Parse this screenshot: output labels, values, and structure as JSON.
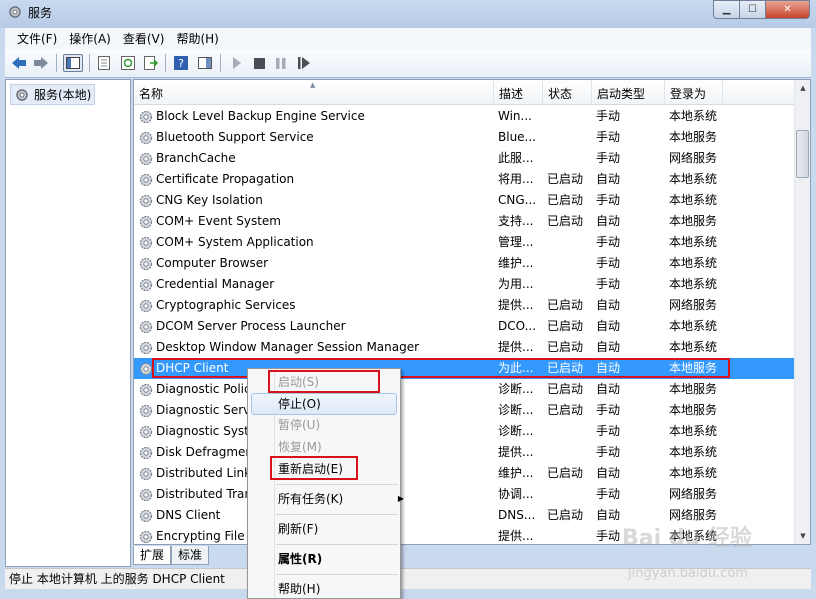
{
  "window": {
    "title": "服务"
  },
  "menubar": [
    {
      "label": "文件(F)"
    },
    {
      "label": "操作(A)"
    },
    {
      "label": "查看(V)"
    },
    {
      "label": "帮助(H)"
    }
  ],
  "tree": {
    "root_label": "服务(本地)"
  },
  "columns": {
    "name": "名称",
    "description": "描述",
    "status": "状态",
    "startup": "启动类型",
    "logon": "登录为"
  },
  "services": [
    {
      "name": "Block Level Backup Engine Service",
      "desc": "Win...",
      "status": "",
      "startup": "手动",
      "logon": "本地系统"
    },
    {
      "name": "Bluetooth Support Service",
      "desc": "Blue...",
      "status": "",
      "startup": "手动",
      "logon": "本地服务"
    },
    {
      "name": "BranchCache",
      "desc": "此服...",
      "status": "",
      "startup": "手动",
      "logon": "网络服务"
    },
    {
      "name": "Certificate Propagation",
      "desc": "将用...",
      "status": "已启动",
      "startup": "自动",
      "logon": "本地系统"
    },
    {
      "name": "CNG Key Isolation",
      "desc": "CNG...",
      "status": "已启动",
      "startup": "手动",
      "logon": "本地系统"
    },
    {
      "name": "COM+ Event System",
      "desc": "支持...",
      "status": "已启动",
      "startup": "自动",
      "logon": "本地服务"
    },
    {
      "name": "COM+ System Application",
      "desc": "管理...",
      "status": "",
      "startup": "手动",
      "logon": "本地系统"
    },
    {
      "name": "Computer Browser",
      "desc": "维护...",
      "status": "",
      "startup": "手动",
      "logon": "本地系统"
    },
    {
      "name": "Credential Manager",
      "desc": "为用...",
      "status": "",
      "startup": "手动",
      "logon": "本地系统"
    },
    {
      "name": "Cryptographic Services",
      "desc": "提供...",
      "status": "已启动",
      "startup": "自动",
      "logon": "网络服务"
    },
    {
      "name": "DCOM Server Process Launcher",
      "desc": "DCO...",
      "status": "已启动",
      "startup": "自动",
      "logon": "本地系统"
    },
    {
      "name": "Desktop Window Manager Session Manager",
      "desc": "提供...",
      "status": "已启动",
      "startup": "自动",
      "logon": "本地系统"
    },
    {
      "name": "DHCP Client",
      "desc": "为此...",
      "status": "已启动",
      "startup": "自动",
      "logon": "本地服务"
    },
    {
      "name": "Diagnostic Polic",
      "desc": "诊断...",
      "status": "已启动",
      "startup": "自动",
      "logon": "本地服务"
    },
    {
      "name": "Diagnostic Servi",
      "desc": "诊断...",
      "status": "已启动",
      "startup": "手动",
      "logon": "本地服务"
    },
    {
      "name": "Diagnostic Syste",
      "desc": "诊断...",
      "status": "",
      "startup": "手动",
      "logon": "本地系统"
    },
    {
      "name": "Disk Defragmen",
      "desc": "提供...",
      "status": "",
      "startup": "手动",
      "logon": "本地系统"
    },
    {
      "name": "Distributed Link",
      "desc": "维护...",
      "status": "已启动",
      "startup": "自动",
      "logon": "本地系统"
    },
    {
      "name": "Distributed Tran",
      "desc": "协调...",
      "status": "",
      "startup": "手动",
      "logon": "网络服务"
    },
    {
      "name": "DNS Client",
      "desc": "DNS...",
      "status": "已启动",
      "startup": "自动",
      "logon": "网络服务"
    },
    {
      "name": "Encrypting File S",
      "desc": "提供...",
      "status": "",
      "startup": "手动",
      "logon": "本地系统"
    }
  ],
  "tabs": [
    {
      "label": "扩展"
    },
    {
      "label": "标准"
    }
  ],
  "statusbar": {
    "text": "停止 本地计算机 上的服务 DHCP Client"
  },
  "context_menu": {
    "start": "启动(S)",
    "stop": "停止(O)",
    "pause": "暂停(U)",
    "resume": "恢复(M)",
    "restart": "重新启动(E)",
    "all_tasks": "所有任务(K)",
    "refresh": "刷新(F)",
    "properties": "属性(R)",
    "help": "帮助(H)"
  },
  "watermark": {
    "brand": "Bai du 经验",
    "url": "jingyan.baidu.com"
  },
  "colors": {
    "selection": "#3399ff",
    "highlight": "#d8121b"
  }
}
